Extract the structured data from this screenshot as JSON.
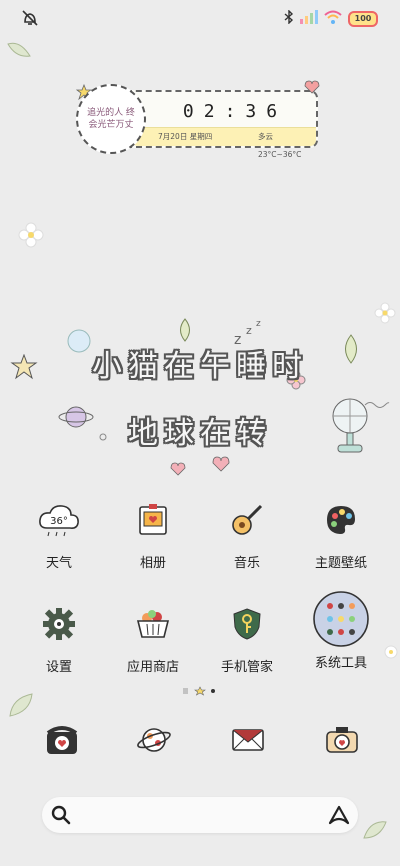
{
  "status_bar": {
    "left_icon": "muted-notification-icon",
    "right_icons": [
      "bluetooth-icon",
      "signal-bars-icon",
      "wifi-icon",
      "battery-icon"
    ],
    "battery_level": "100"
  },
  "widget": {
    "circle_text": "追光的人 终会光芒万丈",
    "time": "02:36",
    "date": "7月20日 星期四",
    "weather": "多云 23°C~36°C"
  },
  "wallpaper": {
    "line1": "小猫在午睡时",
    "line2": "地球在转"
  },
  "apps": [
    {
      "label": "天气",
      "icon": "weather-cloud-icon",
      "badge": "36°"
    },
    {
      "label": "相册",
      "icon": "photo-album-icon"
    },
    {
      "label": "音乐",
      "icon": "guitar-icon"
    },
    {
      "label": "主题壁纸",
      "icon": "palette-icon"
    },
    {
      "label": "设置",
      "icon": "gear-icon"
    },
    {
      "label": "应用商店",
      "icon": "shopping-basket-icon"
    },
    {
      "label": "手机管家",
      "icon": "shield-key-icon"
    },
    {
      "label": "系统工具",
      "icon": "tools-folder-icon"
    }
  ],
  "page_indicator": {
    "pages": 3,
    "current": 2
  },
  "dock": [
    {
      "icon": "phone-icon"
    },
    {
      "icon": "planet-icon"
    },
    {
      "icon": "message-envelope-icon"
    },
    {
      "icon": "camera-icon"
    }
  ],
  "search": {
    "placeholder": ""
  },
  "colors": {
    "background": "#ececec",
    "accent_strip": "#fdf1b5",
    "outline": "#555555"
  }
}
